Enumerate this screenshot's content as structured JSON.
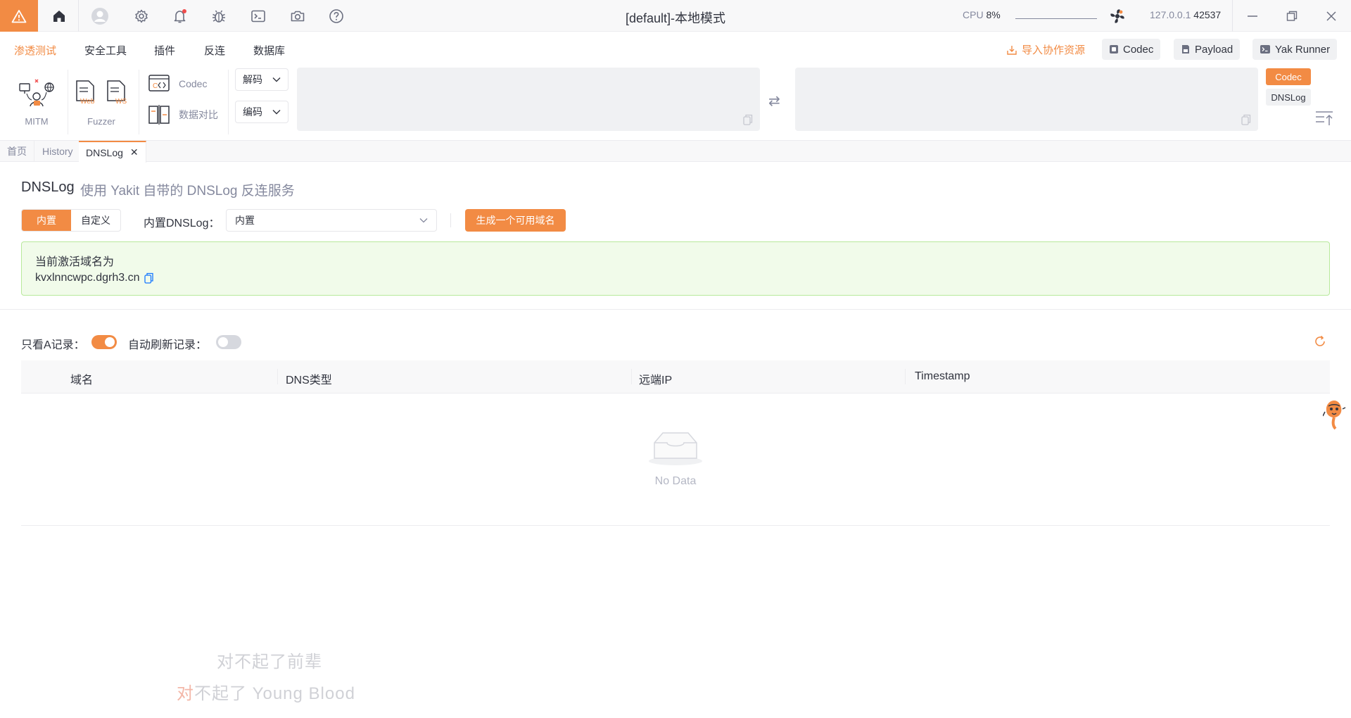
{
  "titlebar": {
    "title": "[default]-本地模式",
    "cpu_label": "CPU",
    "cpu_value": "8%",
    "address_host": "127.0.0.1",
    "address_port": "42537"
  },
  "menu": {
    "items": [
      "渗透测试",
      "安全工具",
      "插件",
      "反连",
      "数据库"
    ],
    "active_index": 0,
    "import_label": "导入协作资源",
    "buttons": [
      "Codec",
      "Payload",
      "Yak Runner"
    ]
  },
  "toolbar": {
    "mitm_label": "MITM",
    "fuzzer_label": "Fuzzer",
    "fuzzer_web_tag": "Web",
    "fuzzer_ws_tag": "WS",
    "codec_label": "Codec",
    "compare_label": "数据对比",
    "decode_label": "解码",
    "encode_label": "编码",
    "side_tags": [
      "Codec",
      "DNSLog"
    ]
  },
  "tabs": [
    {
      "label": "首页",
      "active": false
    },
    {
      "label": "History",
      "active": false
    },
    {
      "label": "DNSLog",
      "active": true,
      "closable": true
    }
  ],
  "page": {
    "title": "DNSLog",
    "subtitle": "使用 Yakit 自带的 DNSLog 反连服务",
    "mode_options": [
      "内置",
      "自定义"
    ],
    "mode_selected": "内置",
    "dnslog_label": "内置DNSLog：",
    "dnslog_value": "内置",
    "generate_button": "生成一个可用域名",
    "alert_title": "当前激活域名为",
    "active_domain": "kvxlnncwpc.dgrh3.cn",
    "only_a_label": "只看A记录：",
    "only_a_enabled": true,
    "auto_refresh_label": "自动刷新记录：",
    "auto_refresh_enabled": false
  },
  "table": {
    "columns": [
      "域名",
      "DNS类型",
      "远端IP",
      "Timestamp"
    ],
    "rows": [],
    "empty_text": "No Data"
  },
  "subtitles": {
    "line1": "对不起了前辈",
    "line2_highlight": "对",
    "line2_rest": "不起了 Young Blood"
  },
  "colors": {
    "accent": "#f28b44",
    "success_bg": "#f1fbea",
    "success_border": "#b8e99b"
  }
}
